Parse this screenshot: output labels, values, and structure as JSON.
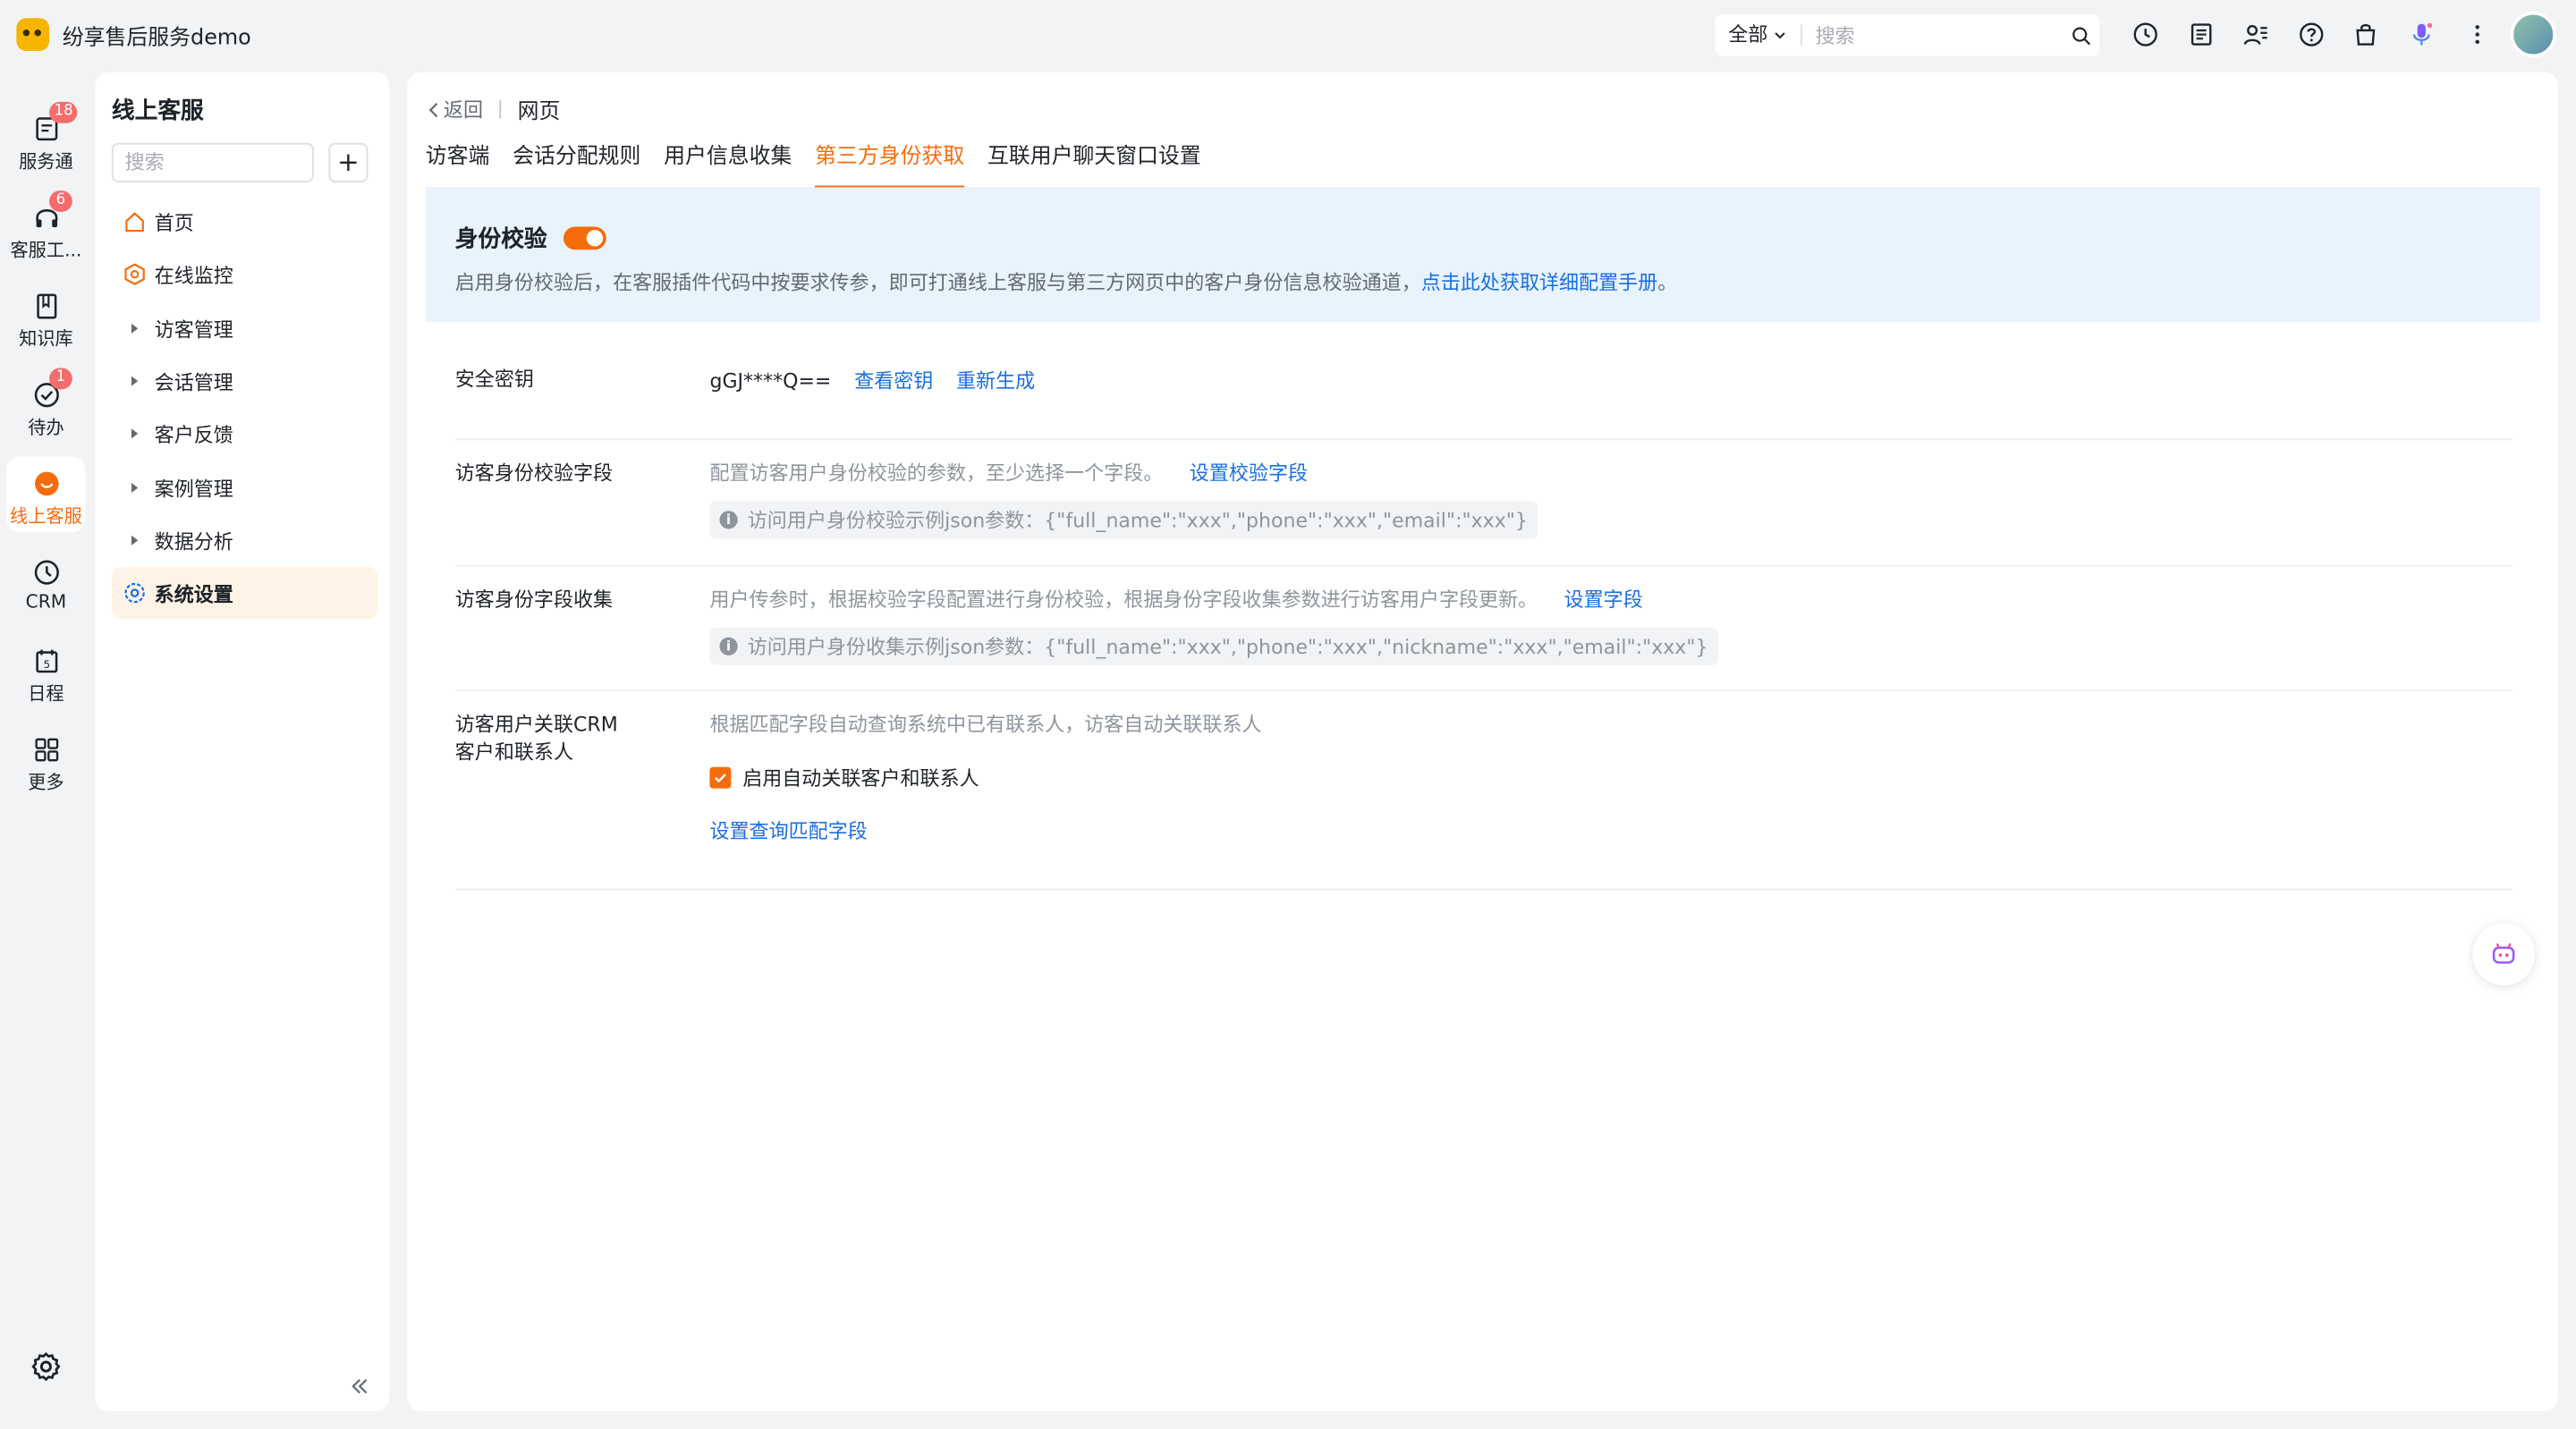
{
  "app": {
    "name": "纷享售后服务demo"
  },
  "search": {
    "scope": "全部",
    "placeholder": "搜索"
  },
  "rail": {
    "items": [
      {
        "label": "服务通",
        "badge": "18"
      },
      {
        "label": "客服工...",
        "badge": "6"
      },
      {
        "label": "知识库",
        "badge": ""
      },
      {
        "label": "待办",
        "badge": "1"
      },
      {
        "label": "线上客服",
        "badge": ""
      },
      {
        "label": "CRM",
        "badge": ""
      },
      {
        "label": "日程",
        "badge": ""
      },
      {
        "label": "更多",
        "badge": ""
      }
    ],
    "active_index": 4
  },
  "sidebar": {
    "title": "线上客服",
    "search_placeholder": "搜索",
    "items": [
      {
        "label": "首页"
      },
      {
        "label": "在线监控"
      },
      {
        "label": "访客管理"
      },
      {
        "label": "会话管理"
      },
      {
        "label": "客户反馈"
      },
      {
        "label": "案例管理"
      },
      {
        "label": "数据分析"
      },
      {
        "label": "系统设置"
      }
    ]
  },
  "breadcrumb": {
    "back": "返回",
    "current": "网页"
  },
  "tabs": [
    {
      "label": "访客端"
    },
    {
      "label": "会话分配规则"
    },
    {
      "label": "用户信息收集"
    },
    {
      "label": "第三方身份获取"
    },
    {
      "label": "互联用户聊天窗口设置"
    }
  ],
  "active_tab": "第三方身份获取",
  "banner": {
    "title": "身份校验",
    "toggle_on": true,
    "desc": "启用身份校验后，在客服插件代码中按要求传参，即可打通线上客服与第三方网页中的客户身份信息校验通道，",
    "link": "点击此处获取详细配置手册",
    "desc_end": "。"
  },
  "settings": {
    "secret": {
      "label": "安全密钥",
      "value": "gGJ****Q==",
      "view": "查看密钥",
      "regen": "重新生成"
    },
    "verify_fields": {
      "label": "访客身份校验字段",
      "desc": "配置访客用户身份校验的参数，至少选择一个字段。",
      "link": "设置校验字段",
      "hint": "访问用户身份校验示例json参数：{\"full_name\":\"xxx\",\"phone\":\"xxx\",\"email\":\"xxx\"}"
    },
    "collect_fields": {
      "label": "访客身份字段收集",
      "desc": "用户传参时，根据校验字段配置进行身份校验，根据身份字段收集参数进行访客用户字段更新。",
      "link": "设置字段",
      "hint": "访问用户身份收集示例json参数：{\"full_name\":\"xxx\",\"phone\":\"xxx\",\"nickname\":\"xxx\",\"email\":\"xxx\"}"
    },
    "crm_link": {
      "label_line1": "访客用户关联CRM",
      "label_line2": "客户和联系人",
      "desc": "根据匹配字段自动查询系统中已有联系人，访客自动关联联系人",
      "checkbox_label": "启用自动关联客户和联系人",
      "checked": true,
      "link": "设置查询匹配字段"
    }
  },
  "colors": {
    "accent": "#f56c0c",
    "link": "#1a6fe0",
    "banner_bg": "#e8f3fd"
  }
}
